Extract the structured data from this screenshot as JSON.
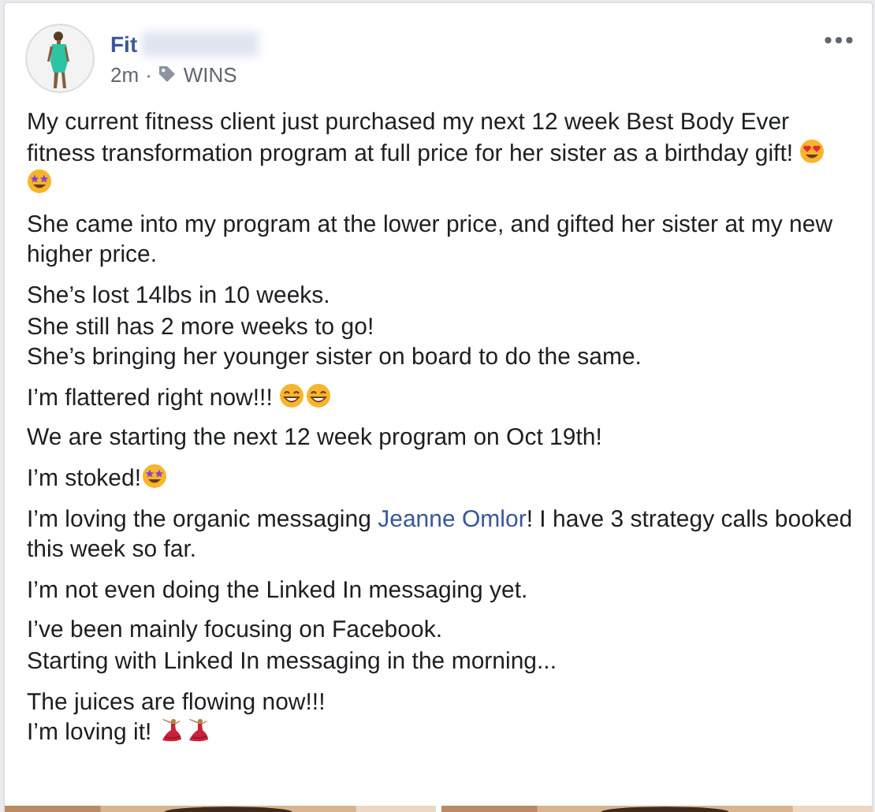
{
  "post": {
    "author": "Fit",
    "time": "2m",
    "separator": "·",
    "topic": "WINS",
    "paragraphs": [
      {
        "lines": [
          [
            {
              "kind": "text",
              "text": "My current fitness client just purchased my next 12 week Best Body Ever fitness transformation program at full price for her sister as a birthday gift! "
            },
            {
              "kind": "heart-eyes"
            },
            {
              "kind": "star-eyes"
            }
          ]
        ]
      },
      {
        "lines": [
          [
            {
              "kind": "text",
              "text": "She came into my program at the lower price, and gifted her sister at my new higher price."
            }
          ]
        ]
      },
      {
        "lines": [
          [
            {
              "kind": "text",
              "text": "She’s lost 14lbs in 10 weeks."
            }
          ],
          [
            {
              "kind": "text",
              "text": "She still has 2 more weeks to go!"
            }
          ],
          [
            {
              "kind": "text",
              "text": "She’s bringing her younger sister on board to do the same."
            }
          ]
        ]
      },
      {
        "lines": [
          [
            {
              "kind": "text",
              "text": "I’m flattered right now!!! "
            },
            {
              "kind": "grin"
            },
            {
              "kind": "grin"
            }
          ]
        ]
      },
      {
        "lines": [
          [
            {
              "kind": "text",
              "text": "We are starting the next 12 week program on Oct 19th!"
            }
          ]
        ]
      },
      {
        "lines": [
          [
            {
              "kind": "text",
              "text": "I’m stoked!"
            },
            {
              "kind": "star-eyes"
            }
          ]
        ]
      },
      {
        "lines": [
          [
            {
              "kind": "text",
              "text": "I’m loving the organic messaging "
            },
            {
              "kind": "link",
              "text": "Jeanne Omlor"
            },
            {
              "kind": "text",
              "text": "! I have 3 strategy calls booked this week so far."
            }
          ]
        ]
      },
      {
        "lines": [
          [
            {
              "kind": "text",
              "text": "I’m not even doing the Linked In messaging yet."
            }
          ]
        ]
      },
      {
        "lines": [
          [
            {
              "kind": "text",
              "text": "I’ve been mainly focusing on Facebook."
            }
          ],
          [
            {
              "kind": "text",
              "text": "Starting with Linked In messaging in the morning..."
            }
          ]
        ]
      },
      {
        "lines": [
          [
            {
              "kind": "text",
              "text": "The juices are flowing now!!!"
            }
          ],
          [
            {
              "kind": "text",
              "text": "I’m loving it! "
            },
            {
              "kind": "dancer"
            },
            {
              "kind": "dancer"
            }
          ]
        ]
      }
    ]
  }
}
